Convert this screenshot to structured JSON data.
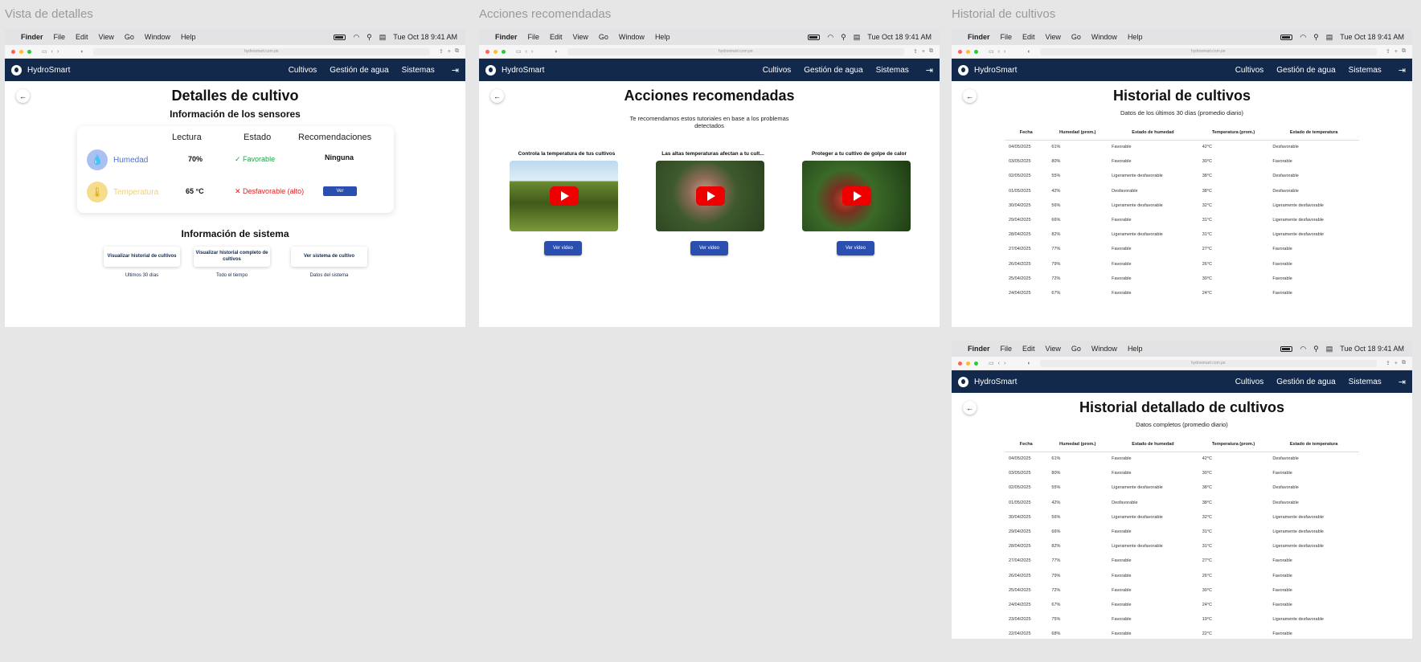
{
  "frames": {
    "f1": "Vista de detalles",
    "f2": "Acciones recomendadas",
    "f3": "Historial de cultivos"
  },
  "menubar": {
    "app": "Finder",
    "items": [
      "File",
      "Edit",
      "View",
      "Go",
      "Window",
      "Help"
    ],
    "datetime": "Tue Oct 18  9:41 AM"
  },
  "browser": {
    "url": "hydrosmart.com.pe"
  },
  "nav": {
    "brand": "HydroSmart",
    "links": [
      "Cultivos",
      "Gestión de agua",
      "Sistemas"
    ]
  },
  "details": {
    "title": "Detalles de cultivo",
    "sensors_title": "Información de los sensores",
    "headers": [
      "Lectura",
      "Estado",
      "Recomendaciones"
    ],
    "rows": [
      {
        "name": "Humedad",
        "reading": "70%",
        "status": "Favorable",
        "rec": "Ninguna"
      },
      {
        "name": "Temperatura",
        "reading": "65 °C",
        "status": "Desfavorable (alto)",
        "rec": "Ver"
      }
    ],
    "system_title": "Información de sistema",
    "buttons": [
      {
        "label": "Visualizar historial de cultivos",
        "sub": "Ultimos 30 días"
      },
      {
        "label": "Visualizar historial completo de cultivos",
        "sub": "Todo el tiempo"
      },
      {
        "label": "Ver sistema de cultivo",
        "sub": "Datos del sistema"
      }
    ]
  },
  "actions": {
    "title": "Acciones recomendadas",
    "subtitle": "Te recomendamos estos tutoriales en base a los problemas detectados",
    "videos": [
      {
        "title": "Controla la temperatura de tus cultivos",
        "btn": "Ver video"
      },
      {
        "title": "Las altas temperaturas afectan a tu cult...",
        "btn": "Ver video"
      },
      {
        "title": "Proteger a tu cultivo de golpe de calor",
        "btn": "Ver video"
      }
    ]
  },
  "history": {
    "title": "Historial de cultivos",
    "subtitle": "Datos de los últimos 30 días (promedio diario)",
    "headers": [
      "Fecha",
      "Humedad (prom.)",
      "Estado de humedad",
      "Temperatura (prom.)",
      "Estado de temperatura"
    ],
    "rows": [
      [
        "04/05/2025",
        "61%",
        "Favorable",
        "42°C",
        "Desfavorable"
      ],
      [
        "03/05/2025",
        "80%",
        "Favorable",
        "30°C",
        "Favorable"
      ],
      [
        "02/05/2025",
        "55%",
        "Ligeramente desfavorable",
        "38°C",
        "Desfavorable"
      ],
      [
        "01/05/2025",
        "42%",
        "Desfavorable",
        "38°C",
        "Desfavorable"
      ],
      [
        "30/04/2025",
        "56%",
        "Ligeramente desfavorable",
        "32°C",
        "Ligeramente desfavorable"
      ],
      [
        "29/04/2025",
        "66%",
        "Favorable",
        "31°C",
        "Ligeramente desfavorable"
      ],
      [
        "28/04/2025",
        "82%",
        "Ligeramente desfavorable",
        "31°C",
        "Ligeramente desfavorable"
      ],
      [
        "27/04/2025",
        "77%",
        "Favorable",
        "27°C",
        "Favorable"
      ],
      [
        "26/04/2025",
        "79%",
        "Favorable",
        "26°C",
        "Favorable"
      ],
      [
        "25/04/2025",
        "72%",
        "Favorable",
        "30°C",
        "Favorable"
      ],
      [
        "24/04/2025",
        "67%",
        "Favorable",
        "24°C",
        "Favorable"
      ]
    ]
  },
  "full_history": {
    "title": "Historial detallado de cultivos",
    "subtitle": "Datos completos (promedio diario)",
    "rows": [
      [
        "04/05/2025",
        "61%",
        "Favorable",
        "42°C",
        "Desfavorable"
      ],
      [
        "03/05/2025",
        "80%",
        "Favorable",
        "30°C",
        "Favorable"
      ],
      [
        "02/05/2025",
        "55%",
        "Ligeramente desfavorable",
        "38°C",
        "Desfavorable"
      ],
      [
        "01/05/2025",
        "42%",
        "Desfavorable",
        "38°C",
        "Desfavorable"
      ],
      [
        "30/04/2025",
        "56%",
        "Ligeramente desfavorable",
        "32°C",
        "Ligeramente desfavorable"
      ],
      [
        "29/04/2025",
        "66%",
        "Favorable",
        "31°C",
        "Ligeramente desfavorable"
      ],
      [
        "28/04/2025",
        "82%",
        "Ligeramente desfavorable",
        "31°C",
        "Ligeramente desfavorable"
      ],
      [
        "27/04/2025",
        "77%",
        "Favorable",
        "27°C",
        "Favorable"
      ],
      [
        "26/04/2025",
        "79%",
        "Favorable",
        "26°C",
        "Favorable"
      ],
      [
        "25/04/2025",
        "72%",
        "Favorable",
        "30°C",
        "Favorable"
      ],
      [
        "24/04/2025",
        "67%",
        "Favorable",
        "24°C",
        "Favorable"
      ],
      [
        "23/04/2025",
        "75%",
        "Favorable",
        "19°C",
        "Ligeramente desfavorable"
      ],
      [
        "22/04/2025",
        "68%",
        "Favorable",
        "22°C",
        "Favorable"
      ]
    ]
  }
}
